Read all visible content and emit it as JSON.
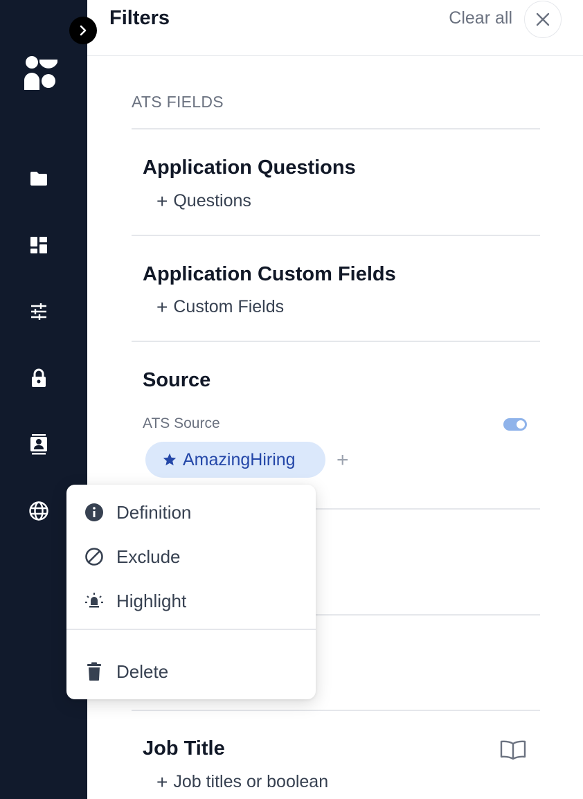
{
  "header": {
    "title": "Filters",
    "clear_all": "Clear all"
  },
  "sections": {
    "group_label": "ATS FIELDS",
    "application_questions": {
      "title": "Application Questions",
      "add_label": "Questions"
    },
    "application_custom_fields": {
      "title": "Application Custom Fields",
      "add_label": "Custom Fields"
    },
    "source": {
      "title": "Source",
      "sub_label": "ATS Source",
      "toggle_on": true,
      "chip_label": "AmazingHiring"
    },
    "job_title": {
      "title": "Job Title",
      "add_label": "Job titles or boolean"
    }
  },
  "context_menu": {
    "items": [
      {
        "label": "Definition",
        "icon": "info-icon"
      },
      {
        "label": "Exclude",
        "icon": "block-icon"
      },
      {
        "label": "Highlight",
        "icon": "highlight-icon"
      },
      {
        "label": "Delete",
        "icon": "trash-icon"
      }
    ]
  },
  "sidebar": {
    "items": [
      "folder-icon",
      "dashboard-icon",
      "sliders-icon",
      "lock-icon",
      "contact-card-icon",
      "globe-icon"
    ]
  },
  "colors": {
    "sidebar_bg": "#111a2c",
    "chip_bg": "#dbe8fb",
    "chip_text": "#2447a8",
    "toggle": "#8fb3ea"
  }
}
